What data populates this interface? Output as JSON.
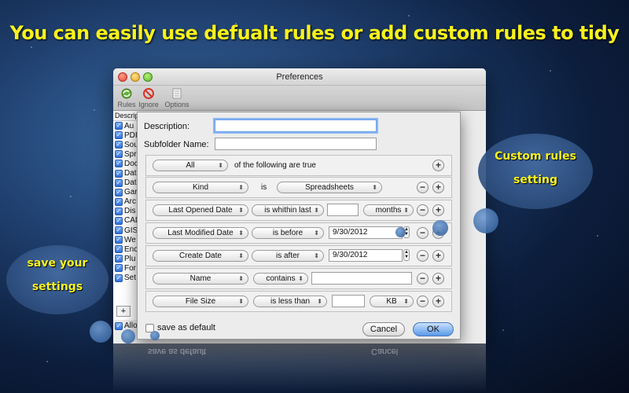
{
  "headline": "You can easily use defualt rules or add custom rules to tidy",
  "window": {
    "title": "Preferences",
    "toolbar": [
      {
        "label": "Rules",
        "icon": "rules-icon"
      },
      {
        "label": "Ignore",
        "icon": "ignore-icon"
      },
      {
        "label": "Options",
        "icon": "options-icon"
      }
    ],
    "list_header": "Descrip",
    "list_items": [
      "Au",
      "PDI",
      "Sou",
      "Spr",
      "Doc",
      "Dat",
      "Dat",
      "Gar",
      "Arc",
      "Dis",
      "CAD",
      "GIS",
      "We",
      "Enc",
      "Plu",
      "For",
      "Set"
    ],
    "add_label": "+",
    "allow_label": "Allo"
  },
  "sheet": {
    "description_label": "Description:",
    "description_value": "",
    "subfolder_label": "Subfolder Name:",
    "subfolder_value": "",
    "match_popup": "All",
    "match_suffix": "of the following are true",
    "rules": [
      {
        "field": "Kind",
        "op_text": "is",
        "value_popup": "Spreadsheets"
      },
      {
        "field": "Last Opened Date",
        "op_popup": "is whithin last",
        "value": "",
        "unit_popup": "months"
      },
      {
        "field": "Last Modified Date",
        "op_popup": "is before",
        "date": "9/30/2012"
      },
      {
        "field": "Create Date",
        "op_popup": "is after",
        "date": "9/30/2012"
      },
      {
        "field": "Name",
        "op_popup": "contains",
        "value": ""
      },
      {
        "field": "File Size",
        "op_popup": "is less than",
        "value": "",
        "unit_popup": "KB"
      }
    ],
    "save_default_label": "save as default",
    "cancel_label": "Cancel",
    "ok_label": "OK"
  },
  "callouts": {
    "custom_line1": "Custom rules",
    "custom_line2": "setting",
    "save_line1": "save your",
    "save_line2": "settings"
  },
  "reflection": {
    "cancel": "Cancel",
    "save": "save as default"
  }
}
